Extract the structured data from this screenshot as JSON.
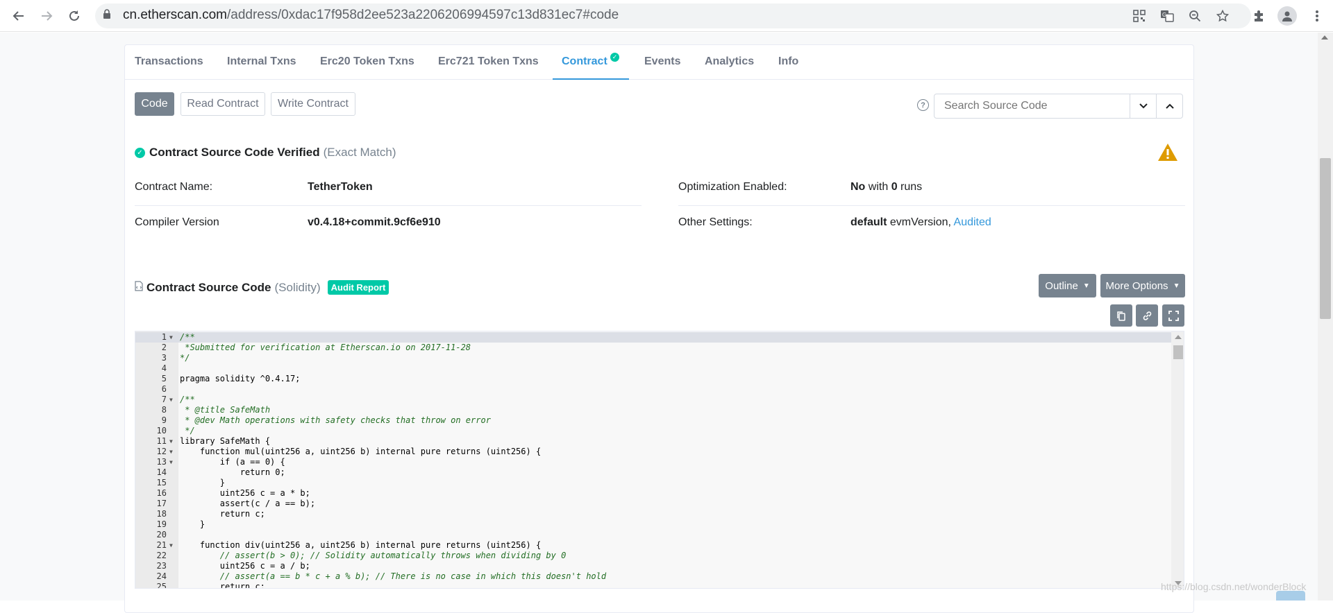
{
  "browser": {
    "url_host": "cn.etherscan.com",
    "url_path": "/address/0xdac17f958d2ee523a2206206994597c13d831ec7#code"
  },
  "tabs": [
    {
      "label": "Transactions",
      "active": false
    },
    {
      "label": "Internal Txns",
      "active": false
    },
    {
      "label": "Erc20 Token Txns",
      "active": false
    },
    {
      "label": "Erc721 Token Txns",
      "active": false
    },
    {
      "label": "Contract",
      "active": true
    },
    {
      "label": "Events",
      "active": false
    },
    {
      "label": "Analytics",
      "active": false
    },
    {
      "label": "Info",
      "active": false
    }
  ],
  "subtabs": {
    "code": "Code",
    "read": "Read Contract",
    "write": "Write Contract"
  },
  "search": {
    "placeholder": "Search Source Code"
  },
  "verified": {
    "title": "Contract Source Code Verified",
    "match": "(Exact Match)"
  },
  "info": {
    "contract_name_label": "Contract Name:",
    "contract_name": "TetherToken",
    "compiler_label": "Compiler Version",
    "compiler": "v0.4.18+commit.9cf6e910",
    "optimization_label": "Optimization Enabled:",
    "optimization_value": "No",
    "optimization_with": "with",
    "optimization_runs": "0",
    "optimization_runs_word": "runs",
    "other_label": "Other Settings:",
    "other_default": "default",
    "other_evm": "evmVersion,",
    "other_audited": "Audited"
  },
  "source": {
    "title": "Contract Source Code",
    "lang": "(Solidity)",
    "audit_badge": "Audit Report",
    "outline": "Outline",
    "more_options": "More Options"
  },
  "code_lines": [
    {
      "n": "1",
      "fold": true,
      "text": "/**"
    },
    {
      "n": "2",
      "fold": false,
      "text": " *Submitted for verification at Etherscan.io on 2017-11-28"
    },
    {
      "n": "3",
      "fold": false,
      "text": "*/"
    },
    {
      "n": "4",
      "fold": false,
      "text": ""
    },
    {
      "n": "5",
      "fold": false,
      "text": "pragma solidity ^0.4.17;"
    },
    {
      "n": "6",
      "fold": false,
      "text": ""
    },
    {
      "n": "7",
      "fold": true,
      "text": "/**"
    },
    {
      "n": "8",
      "fold": false,
      "text": " * @title SafeMath"
    },
    {
      "n": "9",
      "fold": false,
      "text": " * @dev Math operations with safety checks that throw on error"
    },
    {
      "n": "10",
      "fold": false,
      "text": " */"
    },
    {
      "n": "11",
      "fold": true,
      "text": "library SafeMath {"
    },
    {
      "n": "12",
      "fold": true,
      "text": "    function mul(uint256 a, uint256 b) internal pure returns (uint256) {"
    },
    {
      "n": "13",
      "fold": true,
      "text": "        if (a == 0) {"
    },
    {
      "n": "14",
      "fold": false,
      "text": "            return 0;"
    },
    {
      "n": "15",
      "fold": false,
      "text": "        }"
    },
    {
      "n": "16",
      "fold": false,
      "text": "        uint256 c = a * b;"
    },
    {
      "n": "17",
      "fold": false,
      "text": "        assert(c / a == b);"
    },
    {
      "n": "18",
      "fold": false,
      "text": "        return c;"
    },
    {
      "n": "19",
      "fold": false,
      "text": "    }"
    },
    {
      "n": "20",
      "fold": false,
      "text": ""
    },
    {
      "n": "21",
      "fold": true,
      "text": "    function div(uint256 a, uint256 b) internal pure returns (uint256) {"
    },
    {
      "n": "22",
      "fold": false,
      "text": "        // assert(b > 0); // Solidity automatically throws when dividing by 0"
    },
    {
      "n": "23",
      "fold": false,
      "text": "        uint256 c = a / b;"
    },
    {
      "n": "24",
      "fold": false,
      "text": "        // assert(a == b * c + a % b); // There is no case in which this doesn't hold"
    },
    {
      "n": "25",
      "fold": false,
      "text": "        return c;"
    }
  ],
  "watermark": "https://blog.csdn.net/wonderBlock",
  "colors": {
    "accent": "#3498db",
    "success": "#00c9a7",
    "warning": "#de9b00",
    "button_gray": "#77838f"
  }
}
